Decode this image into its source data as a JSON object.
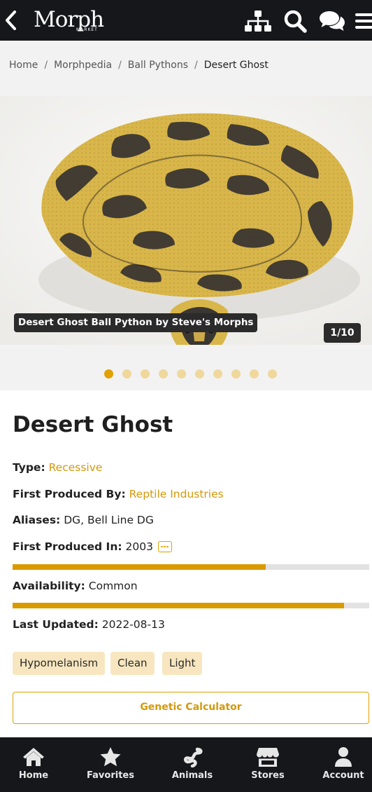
{
  "header": {
    "logo_text": "Morph",
    "logo_sub": "MARKET"
  },
  "breadcrumb": {
    "items": [
      "Home",
      "Morphpedia",
      "Ball Pythons"
    ],
    "current": "Desert Ghost",
    "separator": "/"
  },
  "gallery": {
    "caption": "Desert Ghost Ball Python by Steve's Morphs",
    "counter": "1/10",
    "total": 10,
    "active_index": 0
  },
  "morph": {
    "title": "Desert Ghost",
    "type_label": "Type:",
    "type_value": "Recessive",
    "first_produced_by_label": "First Produced By:",
    "first_produced_by_value": "Reptile Industries",
    "aliases_label": "Aliases:",
    "aliases_value": "DG, Bell Line DG",
    "first_produced_in_label": "First Produced In:",
    "first_produced_in_value": "2003",
    "first_produced_in_level": 0.71,
    "availability_label": "Availability:",
    "availability_value": "Common",
    "availability_level": 0.93,
    "last_updated_label": "Last Updated:",
    "last_updated_value": "2022-08-13",
    "tags": [
      "Hypomelanism",
      "Clean",
      "Light"
    ],
    "calculator_label": "Genetic Calculator"
  },
  "bottom_nav": [
    {
      "label": "Home",
      "icon": "home-icon"
    },
    {
      "label": "Favorites",
      "icon": "star-icon"
    },
    {
      "label": "Animals",
      "icon": "snake-icon"
    },
    {
      "label": "Stores",
      "icon": "store-icon"
    },
    {
      "label": "Account",
      "icon": "user-icon"
    }
  ],
  "colors": {
    "accent": "#e1a100",
    "link": "#d4980a",
    "dark_bar": "#16171b",
    "tag_bg": "#f7e6bf"
  }
}
